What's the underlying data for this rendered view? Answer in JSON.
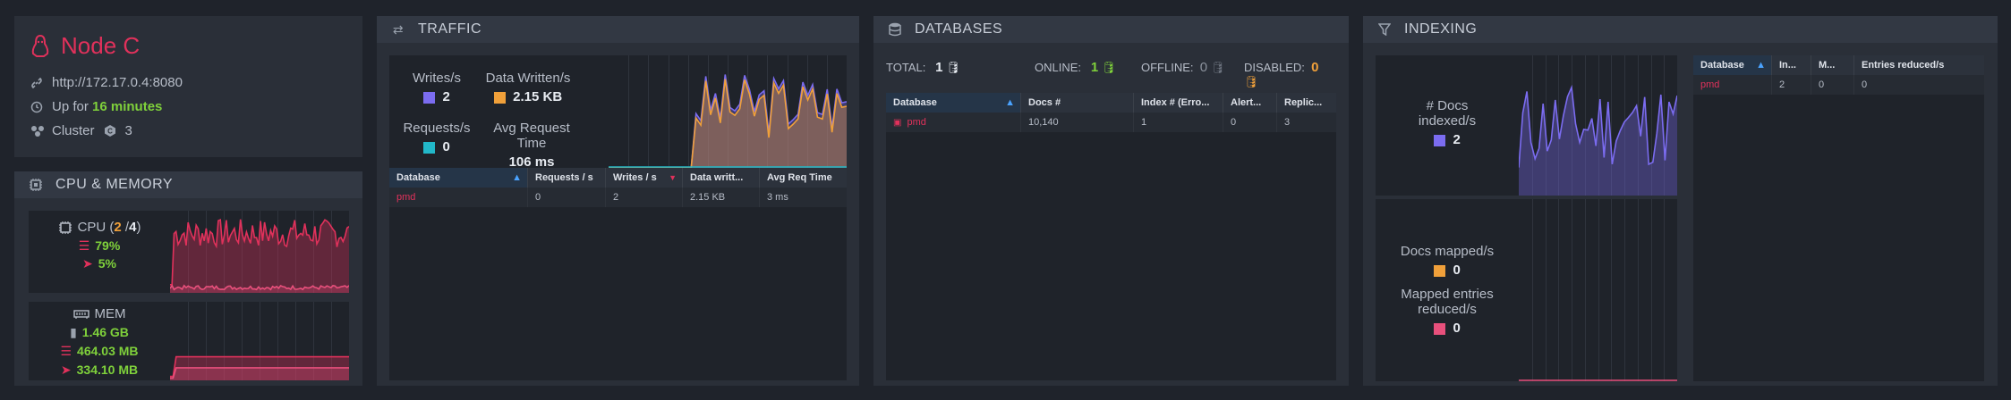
{
  "node": {
    "title": "Node C",
    "url": "http://172.17.0.4:8080",
    "uptime_prefix": "Up for",
    "uptime_value": "16 minutes",
    "cluster_label": "Cluster",
    "cluster_value": "3"
  },
  "cpu_memory": {
    "header": "CPU & MEMORY",
    "cpu_label": "CPU (",
    "cpu_used": "2",
    "cpu_sep": " /",
    "cpu_total": "4",
    "cpu_close": ")",
    "cpu_process": "79%",
    "cpu_machine": "5%",
    "mem_label": "MEM",
    "mem_total": "1.46 GB",
    "mem_working": "464.03 MB",
    "mem_managed": "334.10 MB"
  },
  "traffic": {
    "header": "TRAFFIC",
    "writes_label": "Writes/s",
    "writes_value": "2",
    "data_written_label": "Data Written/s",
    "data_written_value": "2.15 KB",
    "requests_label": "Requests/s",
    "requests_value": "0",
    "avg_label": "Avg Request Time",
    "avg_value": "106 ms",
    "columns": [
      "Database",
      "Requests / s",
      "Writes / s",
      "Data writt...",
      "Avg Req Time"
    ],
    "rows": [
      [
        "pmd",
        "0",
        "2",
        "2.15 KB",
        "3 ms"
      ]
    ]
  },
  "databases": {
    "header": "DATABASES",
    "total_label": "TOTAL:",
    "total_value": "1",
    "online_label": "ONLINE:",
    "online_value": "1",
    "offline_label": "OFFLINE:",
    "offline_value": "0",
    "disabled_label": "DISABLED:",
    "disabled_value": "0",
    "columns": [
      "Database",
      "Docs #",
      "Index # (Erro...",
      "Alert...",
      "Replic..."
    ],
    "rows": [
      [
        "pmd",
        "10,140",
        "1",
        "0",
        "3"
      ]
    ]
  },
  "indexing": {
    "header": "INDEXING",
    "docs_indexed_label_1": "# Docs",
    "docs_indexed_label_2": "indexed/s",
    "docs_indexed_value": "2",
    "docs_mapped_label": "Docs mapped/s",
    "docs_mapped_value": "0",
    "mapped_entries_label_1": "Mapped entries",
    "mapped_entries_label_2": "reduced/s",
    "mapped_entries_value": "0",
    "columns": [
      "Database",
      "In...",
      "M...",
      "Entries reduced/s"
    ],
    "rows": [
      [
        "pmd",
        "2",
        "0",
        "0"
      ]
    ]
  },
  "colors": {
    "accent_red": "#e0315b",
    "green": "#7fd13b",
    "orange": "#f0a03a",
    "purple": "#7b6cf0",
    "cyan": "#22b8c9",
    "pink": "#e8507c"
  },
  "icons": [
    "linux-icon",
    "link-icon",
    "clock-icon",
    "cluster-icon",
    "cpu-icon",
    "memory-icon",
    "traffic-icon",
    "database-icon",
    "filter-icon"
  ]
}
